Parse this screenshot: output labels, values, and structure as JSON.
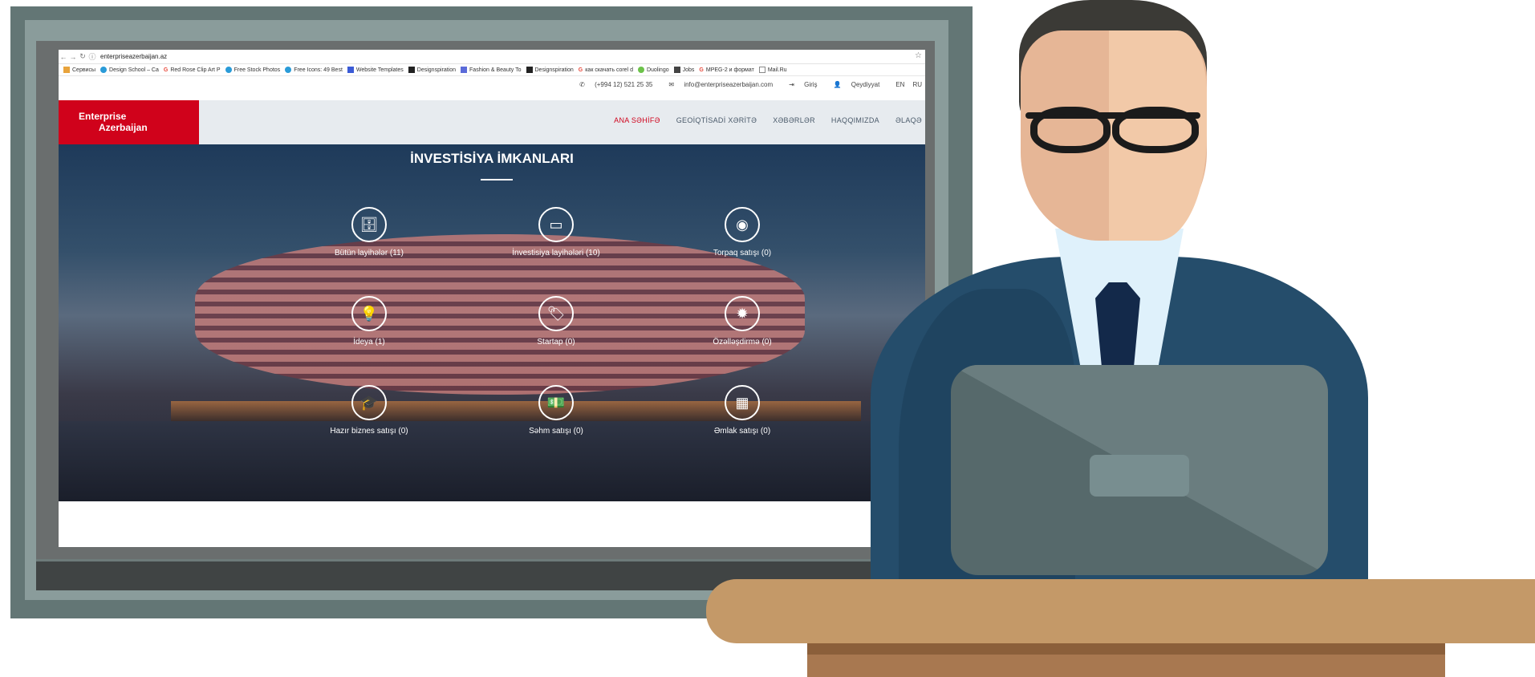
{
  "browser": {
    "url": "enterpriseazerbaijan.az",
    "bookmarks": [
      "Сервисы",
      "Design School – Ca",
      "Red Rose Clip Art P",
      "Free Stock Photos",
      "Free Icons: 49 Best",
      "Website Templates",
      "Designspiration",
      "Fashion & Beauty To",
      "Designspiration",
      "как скачать corel d",
      "Duolingo",
      "Jobs",
      "MPEG-2 и формат",
      "Mail.Ru"
    ]
  },
  "topbar": {
    "phone": "(+994 12) 521 25 35",
    "email": "info@enterpriseazerbaijan.com",
    "login": "Giriş",
    "register": "Qeydiyyat",
    "lang_en": "EN",
    "lang_ru": "RU"
  },
  "logo": {
    "line1": "Enterprise",
    "line2": "Azerbaijan"
  },
  "nav": {
    "home": "ANA SƏHİFƏ",
    "map": "GEOİQTİSADİ XƏRİTƏ",
    "news": "XƏBƏRLƏR",
    "about": "HAQQIMIZDA",
    "contact": "ƏLAQƏ"
  },
  "hero": {
    "title": "İNVESTİSİYA İMKANLARI",
    "items": [
      {
        "label": "Bütün layihələr (11)",
        "icon": "database-icon"
      },
      {
        "label": "İnvestisiya layihələri (10)",
        "icon": "credit-card-icon"
      },
      {
        "label": "Torpaq satışı (0)",
        "icon": "globe-icon"
      },
      {
        "label": "İdeya (1)",
        "icon": "lightbulb-icon"
      },
      {
        "label": "Startap (0)",
        "icon": "tag-icon"
      },
      {
        "label": "Özəlləşdirmə (0)",
        "icon": "badge-icon"
      },
      {
        "label": "Hazır biznes satışı (0)",
        "icon": "graduation-cap-icon"
      },
      {
        "label": "Səhm satışı (0)",
        "icon": "money-bill-icon"
      },
      {
        "label": "Əmlak satışı (0)",
        "icon": "building-icon"
      }
    ]
  }
}
